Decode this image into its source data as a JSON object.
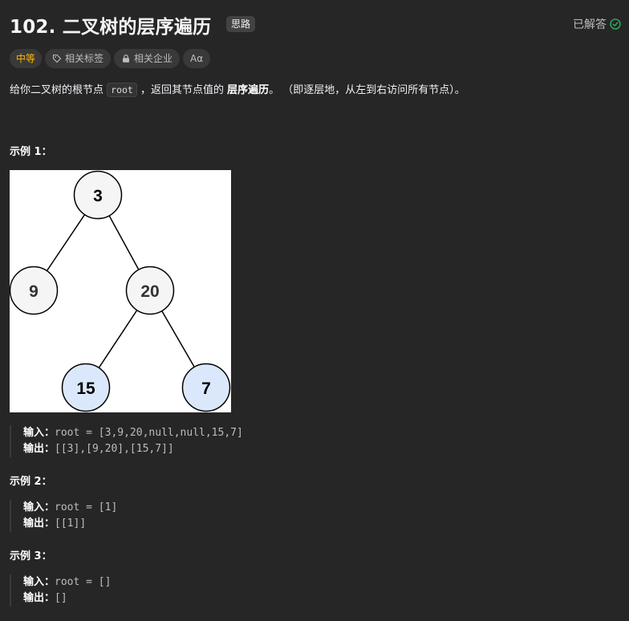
{
  "problem": {
    "title": "102. 二叉树的层序遍历",
    "hint_label": "思路",
    "solved_label": "已解答"
  },
  "tags": {
    "difficulty": "中等",
    "related_tags": "相关标签",
    "related_companies": "相关企业",
    "font_toggle": "Aα"
  },
  "description": {
    "prefix": "给你二叉树的根节点 ",
    "code": "root",
    "middle": " ，返回其节点值的 ",
    "bold": "层序遍历",
    "suffix": "。 （即逐层地，从左到右访问所有节点）。"
  },
  "tree": {
    "nodes": [
      {
        "id": "n3",
        "label": "3",
        "fill": "#f5f5f5"
      },
      {
        "id": "n9",
        "label": "9",
        "fill": "#f5f5f5"
      },
      {
        "id": "n20",
        "label": "20",
        "fill": "#f5f5f5"
      },
      {
        "id": "n15",
        "label": "15",
        "fill": "#dbe8fb"
      },
      {
        "id": "n7",
        "label": "7",
        "fill": "#dbe8fb"
      }
    ]
  },
  "examples": [
    {
      "title": "示例 1：",
      "input_label": "输入：",
      "input": "root = [3,9,20,null,null,15,7]",
      "output_label": "输出：",
      "output": "[[3],[9,20],[15,7]]"
    },
    {
      "title": "示例 2：",
      "input_label": "输入：",
      "input": "root = [1]",
      "output_label": "输出：",
      "output": "[[1]]"
    },
    {
      "title": "示例 3：",
      "input_label": "输入：",
      "input": "root = []",
      "output_label": "输出：",
      "output": "[]"
    }
  ]
}
